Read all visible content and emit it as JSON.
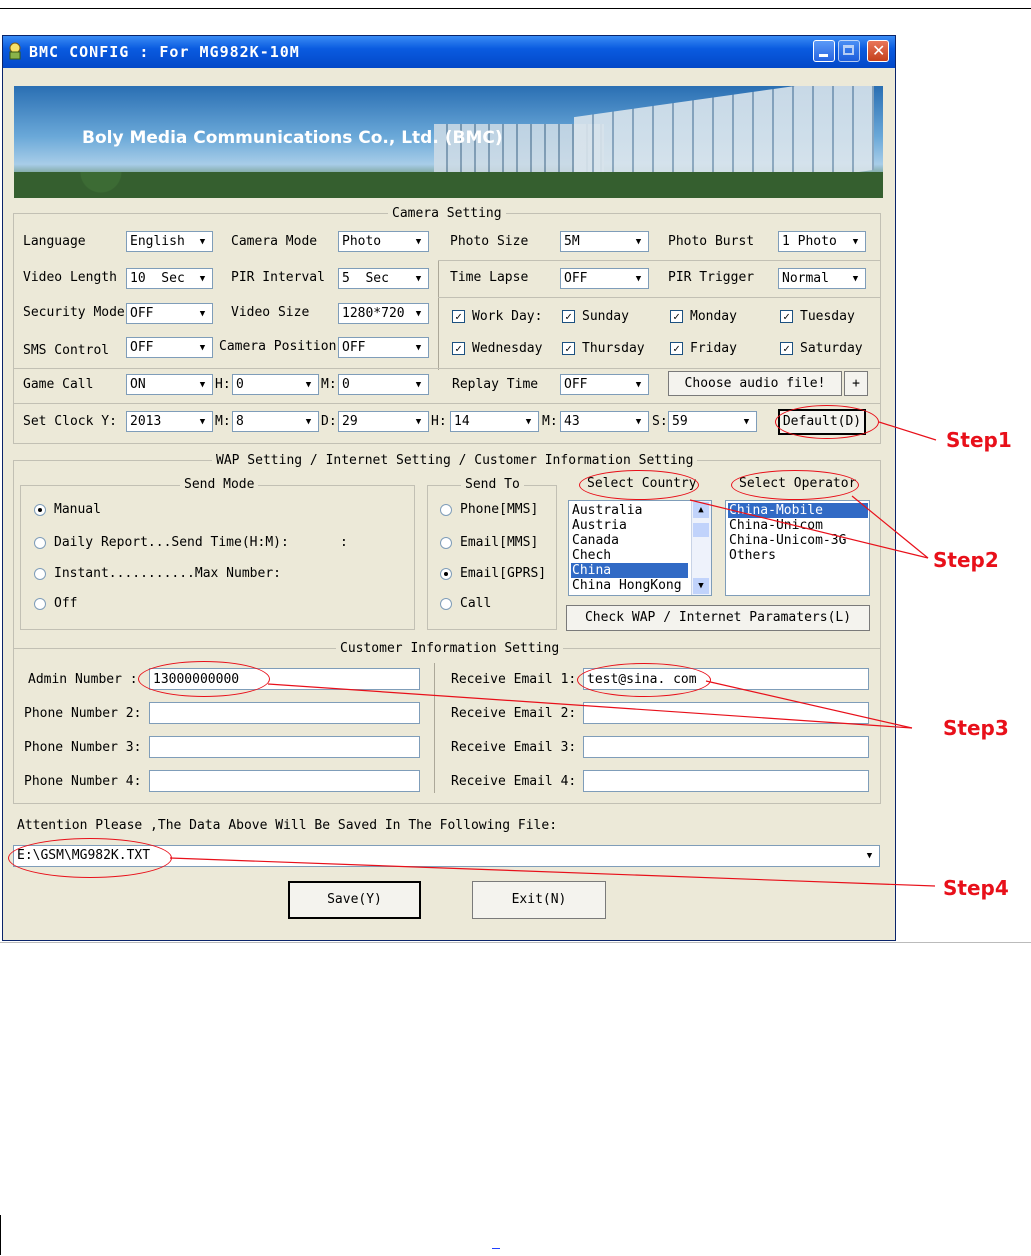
{
  "window": {
    "title": "BMC CONFIG : For MG982K-10M",
    "banner_text": "Boly Media Communications Co., Ltd. (BMC)"
  },
  "camera": {
    "group_title": "Camera Setting",
    "language_label": "Language",
    "language_value": "English",
    "camera_mode_label": "Camera Mode",
    "camera_mode_value": "Photo",
    "photo_size_label": "Photo Size",
    "photo_size_value": "5M",
    "photo_burst_label": "Photo Burst",
    "photo_burst_value": "1 Photo",
    "video_length_label": "Video Length",
    "video_length_value": "10  Sec",
    "pir_interval_label": "PIR Interval",
    "pir_interval_value": "5  Sec",
    "time_lapse_label": "Time Lapse",
    "time_lapse_value": "OFF",
    "pir_trigger_label": "PIR Trigger",
    "pir_trigger_value": "Normal",
    "security_mode_label": "Security Mode",
    "security_mode_value": "OFF",
    "video_size_label": "Video Size",
    "video_size_value": "1280*720",
    "sms_control_label": "SMS Control",
    "sms_control_value": "OFF",
    "camera_position_label": "Camera Position",
    "camera_position_value": "OFF",
    "workday_label": "Work Day:",
    "days": [
      "Sunday",
      "Monday",
      "Tuesday",
      "Wednesday",
      "Thursday",
      "Friday",
      "Saturday"
    ],
    "game_call_label": "Game Call",
    "game_call_value": "ON",
    "game_h_label": "H:",
    "game_h_value": "0",
    "game_m_label": "M:",
    "game_m_value": "0",
    "replay_time_label": "Replay Time",
    "replay_time_value": "OFF",
    "choose_audio_label": "Choose audio file!",
    "plus_label": "+",
    "set_clock_label": "Set Clock Y:",
    "clock_y": "2013",
    "clock_m_label": "M:",
    "clock_m": "8",
    "clock_d_label": "D:",
    "clock_d": "29",
    "clock_h_label": "H:",
    "clock_h": "14",
    "clock_min_label": "M:",
    "clock_min": "43",
    "clock_s_label": "S:",
    "clock_s": "59",
    "default_label": "Default(D)"
  },
  "wap": {
    "group_title": "WAP Setting / Internet Setting / Customer Information Setting",
    "send_mode_title": "Send Mode",
    "modes": [
      "Manual",
      "Daily Report...Send Time(H:M):",
      "Instant...........Max Number:",
      "Off"
    ],
    "time_colon": ":",
    "send_to_title": "Send To",
    "send_to": [
      "Phone[MMS]",
      "Email[MMS]",
      "Email[GPRS]",
      "Call"
    ],
    "select_country_label": "Select Country",
    "countries": [
      "Australia",
      "Austria",
      "Canada",
      "Chech",
      "China",
      "China HongKong"
    ],
    "select_operator_label": "Select Operator",
    "operators": [
      "China-Mobile",
      "China-Unicom",
      "China-Unicom-3G",
      "Others"
    ],
    "check_wap_label": "Check WAP / Internet Paramaters(L)"
  },
  "customer": {
    "group_title": "Customer Information Setting",
    "admin_label": "Admin Number :",
    "admin_value": "13000000000",
    "phone2_label": "Phone Number 2:",
    "phone3_label": "Phone Number 3:",
    "phone4_label": "Phone Number 4:",
    "email1_label": "Receive Email 1:",
    "email1_value": "test@sina. com",
    "email2_label": "Receive Email 2:",
    "email3_label": "Receive Email 3:",
    "email4_label": "Receive Email 4:"
  },
  "footer": {
    "attention": "Attention Please ,The Data Above Will Be Saved In The Following  File:",
    "file_path": "E:\\GSM\\MG982K.TXT",
    "save_label": "Save(Y)",
    "exit_label": "Exit(N)"
  },
  "annotations": {
    "step1": "Step1",
    "step2": "Step2",
    "step3": "Step3",
    "step4": "Step4",
    "color": "#e8101a"
  }
}
